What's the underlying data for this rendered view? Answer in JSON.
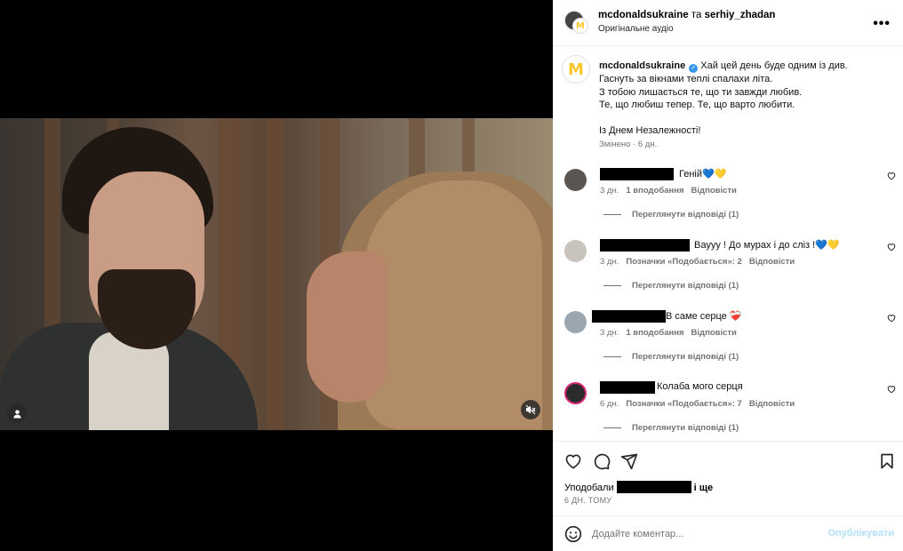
{
  "header": {
    "account": "mcdonaldsukraine",
    "joiner": " та ",
    "collaborator": "serhiy_zhadan",
    "audio": "Оригінальне аудіо",
    "more_icon": "more-horizontal-icon"
  },
  "caption": {
    "user": "mcdonaldsukraine",
    "lines": [
      "Хай цей день буде одним із див.",
      "Гаснуть за вікнами теплі спалахи літа.",
      "З тобою лишається те, що ти завжди любив.",
      "Те, що любиш тепер. Те, що варто любити."
    ],
    "closing": "Із Днем Незалежності!",
    "meta": "Змінено · 6 дн."
  },
  "comments": [
    {
      "text": "Геній💙💛",
      "time": "3 дн.",
      "likes": "1 вподобання",
      "reply": "Відповісти",
      "view_replies": "Переглянути відповіді (1)"
    },
    {
      "text": "Вауyy ! До мурах і до сліз !💙💛",
      "time": "3 дн.",
      "likes": "Позначки «Подобається»: 2",
      "reply": "Відповісти",
      "view_replies": "Переглянути відповіді (1)"
    },
    {
      "text": "В саме серце ❤️‍🩹",
      "time": "3 дн.",
      "likes": "1 вподобання",
      "reply": "Відповісти",
      "view_replies": "Переглянути відповіді (1)"
    },
    {
      "text": "Колаба мого серця",
      "time": "6 дн.",
      "likes": "Позначки «Подобається»: 7",
      "reply": "Відповісти",
      "view_replies": "Переглянути відповіді (1)"
    }
  ],
  "actions": {
    "likes_prefix": "Уподобали",
    "likes_suffix": "і ще",
    "date": "6 ДН. ТОМУ"
  },
  "composer": {
    "placeholder": "Додайте коментар...",
    "post": "Опублікувати"
  },
  "colors": {
    "link_blue": "#b2dffc",
    "verified": "#3897f0",
    "mcd_yellow": "#ffc72c"
  }
}
